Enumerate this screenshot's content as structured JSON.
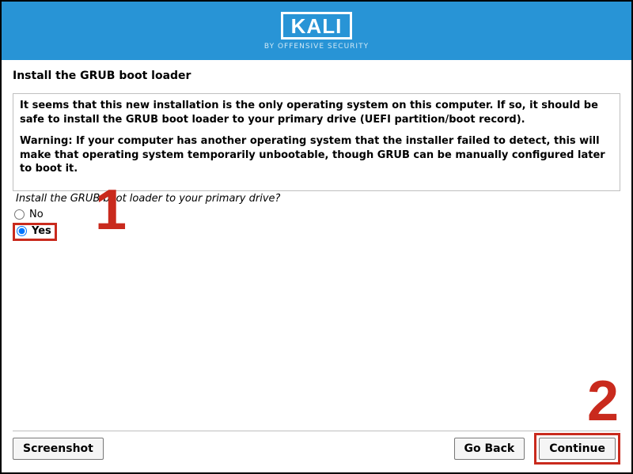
{
  "header": {
    "logo_text": "KALI",
    "logo_sub": "BY OFFENSIVE SECURITY"
  },
  "page": {
    "title": "Install the GRUB boot loader"
  },
  "panel": {
    "para1": "It seems that this new installation is the only operating system on this computer. If so, it should be safe to install the GRUB boot loader to your primary drive (UEFI partition/boot record).",
    "para2": "Warning: If your computer has another operating system that the installer failed to detect, this will make that operating system temporarily unbootable, though GRUB can be manually configured later to boot it."
  },
  "question": "Install the GRUB boot loader to your primary drive?",
  "options": {
    "no_label": "No",
    "yes_label": "Yes",
    "selected": "yes"
  },
  "footer": {
    "screenshot_label": "Screenshot",
    "goback_label": "Go Back",
    "continue_label": "Continue"
  },
  "annotations": {
    "one": "1",
    "two": "2"
  }
}
